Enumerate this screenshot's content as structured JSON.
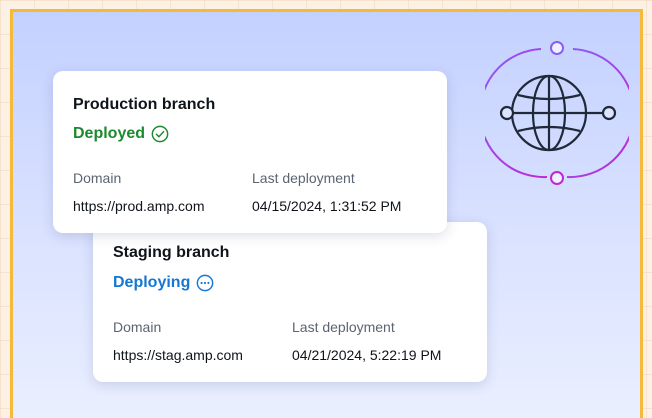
{
  "production": {
    "title": "Production branch",
    "status": "Deployed",
    "status_icon": "check-circle-icon",
    "domain_label": "Domain",
    "domain_value": "https://prod.amp.com",
    "deploy_label": "Last deployment",
    "deploy_value": "04/15/2024, 1:31:52 PM"
  },
  "staging": {
    "title": "Staging branch",
    "status": "Deploying",
    "status_icon": "ellipsis-circle-icon",
    "domain_label": "Domain",
    "domain_value": "https://stag.amp.com",
    "deploy_label": "Last deployment",
    "deploy_value": "04/21/2024, 5:22:19 PM"
  },
  "colors": {
    "deployed": "#1b8a2c",
    "deploying": "#1677d2",
    "frame_border": "#f6b93a",
    "globe_stroke": "#1f2937",
    "ring_accent": "#a855f7"
  }
}
